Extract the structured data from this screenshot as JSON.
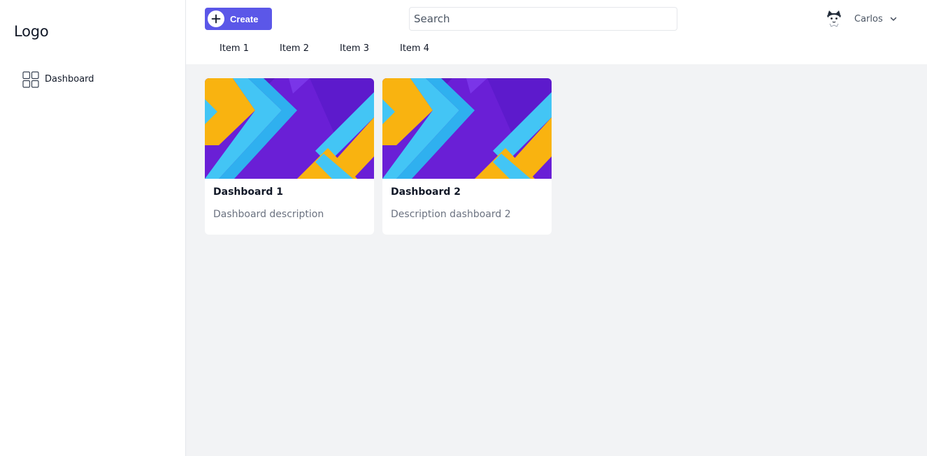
{
  "sidebar": {
    "logo": "Logo",
    "items": [
      {
        "label": "Dashboard",
        "icon": "dashboard-grid-icon"
      }
    ]
  },
  "header": {
    "create_label": "Create",
    "search_placeholder": "Search",
    "search_value": "",
    "user_name": "Carlos",
    "tabs": [
      {
        "label": "Item 1"
      },
      {
        "label": "Item 2"
      },
      {
        "label": "Item 3"
      },
      {
        "label": "Item 4"
      }
    ]
  },
  "dashboards": [
    {
      "title": "Dashboard 1",
      "description": "Dashboard description"
    },
    {
      "title": "Dashboard 2",
      "description": "Description dashboard 2"
    }
  ],
  "colors": {
    "accent": "#5b57e8",
    "background": "#f2f3f5",
    "card_purple": "#6a1fd6",
    "card_blue": "#43c5f5",
    "card_yellow": "#f9b310"
  }
}
